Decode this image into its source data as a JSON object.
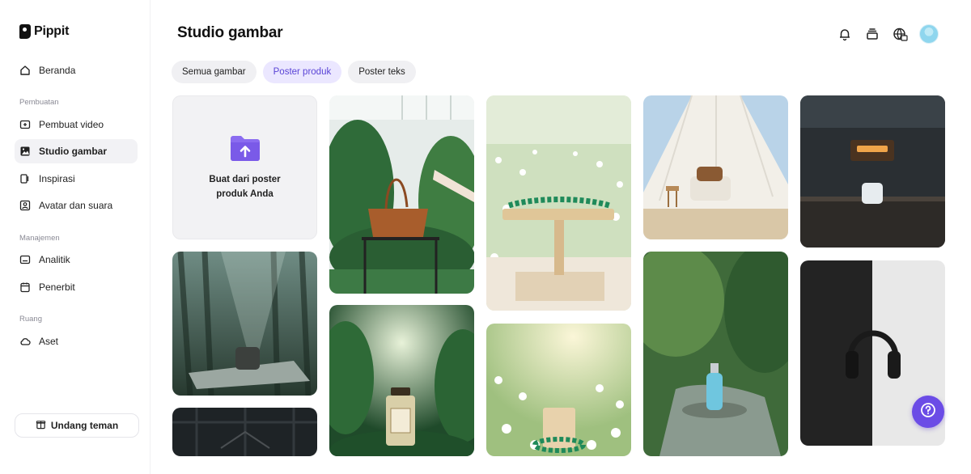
{
  "app": {
    "name": "Pippit"
  },
  "sidebar": {
    "items": [
      {
        "label": "Beranda",
        "icon": "home-icon"
      },
      {
        "label": "Pembuat video",
        "icon": "video-add-icon"
      },
      {
        "label": "Studio gambar",
        "icon": "image-studio-icon",
        "active": true
      },
      {
        "label": "Inspirasi",
        "icon": "inspiration-icon"
      },
      {
        "label": "Avatar dan suara",
        "icon": "avatar-icon"
      },
      {
        "label": "Analitik",
        "icon": "analytics-icon"
      },
      {
        "label": "Penerbit",
        "icon": "calendar-icon"
      },
      {
        "label": "Aset",
        "icon": "cloud-icon"
      }
    ],
    "sections": {
      "creation": "Pembuatan",
      "management": "Manajemen",
      "space": "Ruang"
    },
    "invite_label": "Undang teman"
  },
  "header": {
    "title": "Studio gambar",
    "icons": [
      "bell-icon",
      "layers-icon",
      "globe-language-icon",
      "avatar"
    ]
  },
  "tabs": [
    {
      "label": "Semua gambar",
      "active": false
    },
    {
      "label": "Poster produk",
      "active": true
    },
    {
      "label": "Poster teks",
      "active": false
    }
  ],
  "upload_card": {
    "label": "Buat dari poster produk Anda"
  },
  "gallery": [
    {
      "subject": "speaker on mat in misty forest"
    },
    {
      "subject": "dark industrial interior"
    },
    {
      "subject": "brown leather tote bag on stand among plants"
    },
    {
      "subject": "perfume bottle in jungle"
    },
    {
      "subject": "green bead bracelet on wooden stand in daisy field"
    },
    {
      "subject": "bracelet on wooden block in daisy field"
    },
    {
      "subject": "armchair inside white bell tent on sand"
    },
    {
      "subject": "glass bottle on rock by forest stream"
    },
    {
      "subject": "earbuds case on dark workshop counter"
    },
    {
      "subject": "headphones on black and white split background"
    }
  ],
  "colors": {
    "accent": "#6b4ce6",
    "tab_active_bg": "#ebe7ff",
    "tab_active_text": "#5a44d6"
  }
}
